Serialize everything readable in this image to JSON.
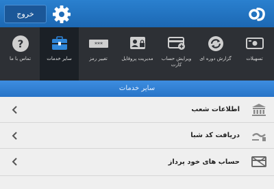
{
  "topbar": {
    "logout_label": "خروج"
  },
  "menu": {
    "items": [
      {
        "key": "facilities",
        "label": "تسهیلات"
      },
      {
        "key": "periodic-report",
        "label": "گزارش دوره ای"
      },
      {
        "key": "card-balance",
        "label": "ویرایش حساب کارت"
      },
      {
        "key": "profile",
        "label": "مدیریت پروفایل"
      },
      {
        "key": "password",
        "label": "تغییر رمز"
      },
      {
        "key": "other-services",
        "label": "سایر خدمات",
        "active": true
      },
      {
        "key": "contact",
        "label": "تماس با ما"
      }
    ]
  },
  "section": {
    "title": "سایر خدمات"
  },
  "list": {
    "items": [
      {
        "label": "اطلاعات شعب",
        "icon": "bank-building-icon"
      },
      {
        "label": "دریافت کد شبا",
        "icon": "sheba-icon"
      },
      {
        "label": "حساب های خود پرداز",
        "icon": "atm-card-icon"
      }
    ]
  },
  "colors": {
    "header": "#1c68b3",
    "menu_bg": "#2d3035",
    "accent": "#2874c8"
  }
}
